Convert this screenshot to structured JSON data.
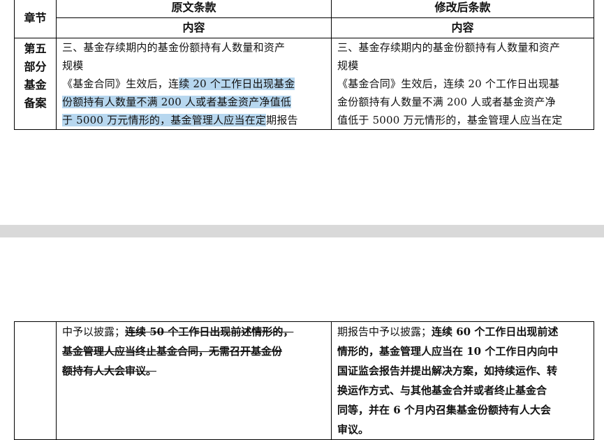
{
  "header": {
    "chapter": "章节",
    "original": "原文条款",
    "modified": "修改后条款",
    "content_left": "内容",
    "content_right": "内容"
  },
  "chapter_lines": [
    "第五",
    "部分",
    "基金",
    "备案"
  ],
  "original": {
    "lines": [
      "三、基金存续期内的基金份额持有人数量和资产",
      "规模"
    ],
    "line3_pre": "《基金合同》生效后，连",
    "line3_hl": "续 20 个工作日出现基金",
    "line4_hl": "份额持有人数量不满  200  人或者基金资产净值低",
    "line5_hl": "于 5000 万元情形的，基金管理人应当在定",
    "line5_post": "期报告"
  },
  "modified": {
    "lines": [
      "三、基金存续期内的基金份额持有人数量和资产",
      "规模",
      "《基金合同》生效后，连续 20 个工作日出现基",
      "金份额持有人数量不满  200  人或者基金资产净",
      "值低于 5000 万元情形的，基金管理人应当在定"
    ]
  },
  "bottom": {
    "left_pre": "中予以披露；",
    "left_strike_1": "连续 50 个工作日出现前述情形的，",
    "left_strike_2": "基金管理人应当终止基金合同，无需召开基金份",
    "left_strike_3": "额持有人大会审议。",
    "right_pre": "期报告中予以披露；",
    "right_bold_1": "连续 60 个工作日出现前述",
    "right_bold_lines": [
      "情形的，基金管理人应当在 10 个工作日内向中",
      "国证监会报告并提出解决方案，如持续运作、转",
      "换运作方式、与其他基金合并或者终止基金合",
      "同等，并在  6  个月内召集基金份额持有人大会",
      "审议。"
    ]
  }
}
